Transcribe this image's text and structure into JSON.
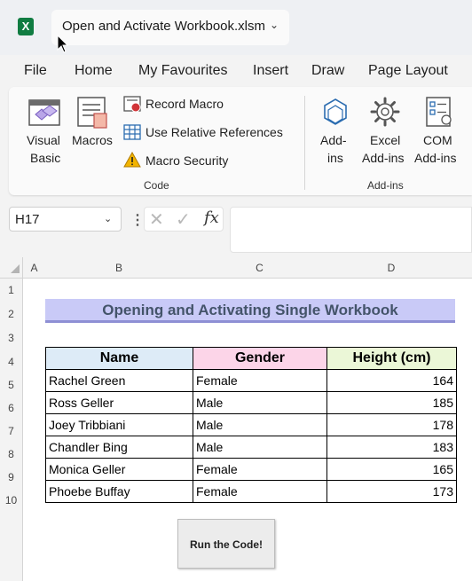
{
  "window": {
    "title": "Open and Activate Workbook.xlsm",
    "app_logo": "X",
    "accent": "#107c41"
  },
  "menu": [
    "File",
    "Home",
    "My Favourites",
    "Insert",
    "Draw",
    "Page Layout"
  ],
  "ribbon": {
    "code_group": {
      "label": "Code",
      "visual_basic": [
        "Visual",
        "Basic"
      ],
      "macros": "Macros",
      "record_macro": "Record Macro",
      "relative_refs": "Use Relative References",
      "macro_security": "Macro Security"
    },
    "addins_group": {
      "label": "Add-ins",
      "addins": [
        "Add-",
        "ins"
      ],
      "excel_addins": [
        "Excel",
        "Add-ins"
      ],
      "com_addins": [
        "COM",
        "Add-ins"
      ]
    }
  },
  "formula_bar": {
    "name_box": "H17",
    "fx_label": "fx",
    "formula": ""
  },
  "sheet": {
    "columns": [
      "A",
      "B",
      "C",
      "D"
    ],
    "rows": [
      "1",
      "2",
      "3",
      "4",
      "5",
      "6",
      "7",
      "8",
      "9",
      "10"
    ],
    "table_title": "Opening and Activating Single Workbook",
    "headers": [
      "Name",
      "Gender",
      "Height (cm)"
    ],
    "header_colors": [
      "#ddebf7",
      "#fcd5e8",
      "#ebf7d7"
    ],
    "data": [
      [
        "Rachel Green",
        "Female",
        "164"
      ],
      [
        "Ross Geller",
        "Male",
        "185"
      ],
      [
        "Joey Tribbiani",
        "Male",
        "178"
      ],
      [
        "Chandler Bing",
        "Male",
        "183"
      ],
      [
        "Monica Geller",
        "Female",
        "165"
      ],
      [
        "Phoebe Buffay",
        "Female",
        "173"
      ]
    ],
    "button_label": "Run the Code!"
  }
}
